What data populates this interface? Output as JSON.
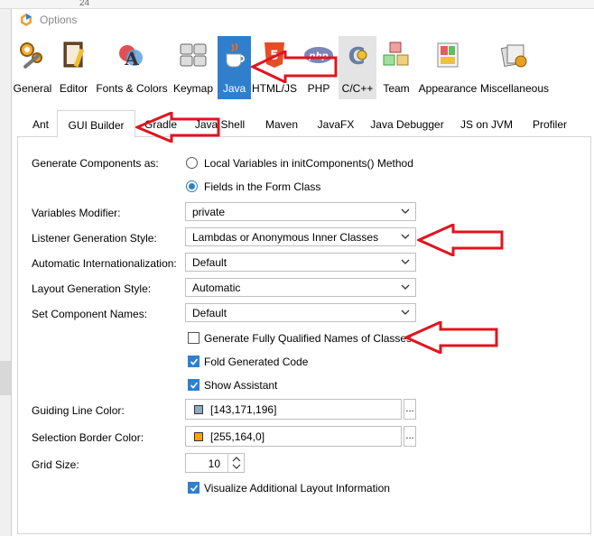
{
  "window": {
    "title": "Options"
  },
  "background": {
    "line_number": "24"
  },
  "categories": [
    {
      "label": "General",
      "icon": "general-icon"
    },
    {
      "label": "Editor",
      "icon": "editor-icon"
    },
    {
      "label": "Fonts & Colors",
      "icon": "fonts-colors-icon"
    },
    {
      "label": "Keymap",
      "icon": "keymap-icon"
    },
    {
      "label": "Java",
      "icon": "java-icon"
    },
    {
      "label": "HTML/JS",
      "icon": "html5-icon"
    },
    {
      "label": "PHP",
      "icon": "php-icon"
    },
    {
      "label": "C/C++",
      "icon": "cpp-icon"
    },
    {
      "label": "Team",
      "icon": "team-icon"
    },
    {
      "label": "Appearance",
      "icon": "appearance-icon"
    },
    {
      "label": "Miscellaneous",
      "icon": "miscellaneous-icon"
    }
  ],
  "tabs": [
    "Ant",
    "GUI Builder",
    "Gradle",
    "Java Shell",
    "Maven",
    "JavaFX",
    "Java Debugger",
    "JS on JVM",
    "Profiler"
  ],
  "form": {
    "generate_components_label": "Generate Components as:",
    "radio_local": "Local Variables in initComponents() Method",
    "radio_fields": "Fields in the Form Class",
    "variables_modifier_label": "Variables Modifier:",
    "variables_modifier_value": "private",
    "listener_style_label": "Listener Generation Style:",
    "listener_style_value": "Lambdas or Anonymous Inner Classes",
    "auto_i18n_label": "Automatic Internationalization:",
    "auto_i18n_value": "Default",
    "layout_style_label": "Layout Generation Style:",
    "layout_style_value": "Automatic",
    "component_names_label": "Set Component Names:",
    "component_names_value": "Default",
    "fq_names_label": "Generate Fully Qualified Names of Classes",
    "fold_code_label": "Fold Generated Code",
    "show_assistant_label": "Show Assistant",
    "guiding_color_label": "Guiding Line Color:",
    "guiding_color_value": "[143,171,196]",
    "guiding_color_hex": "#8fabc4",
    "selection_color_label": "Selection Border Color:",
    "selection_color_value": "[255,164,0]",
    "selection_color_hex": "#ffa400",
    "grid_size_label": "Grid Size:",
    "grid_size_value": "10",
    "visualize_label": "Visualize Additional Layout Information",
    "more_button": "..."
  },
  "colors": {
    "selected": "#2f7fcd",
    "annotation_arrow": "#e0141e"
  }
}
